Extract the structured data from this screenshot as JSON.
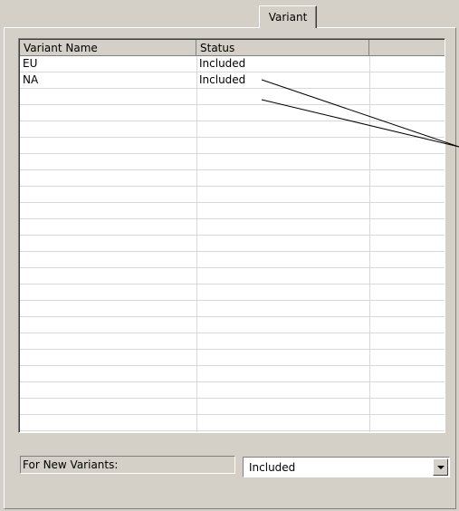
{
  "tab": {
    "label": "Variant"
  },
  "table": {
    "headers": [
      "Variant Name",
      "Status",
      ""
    ],
    "rows": [
      [
        "EU",
        "Included",
        ""
      ],
      [
        "NA",
        "Included",
        ""
      ]
    ]
  },
  "new_variants": {
    "label": "For New Variants:",
    "selected": "Included"
  }
}
